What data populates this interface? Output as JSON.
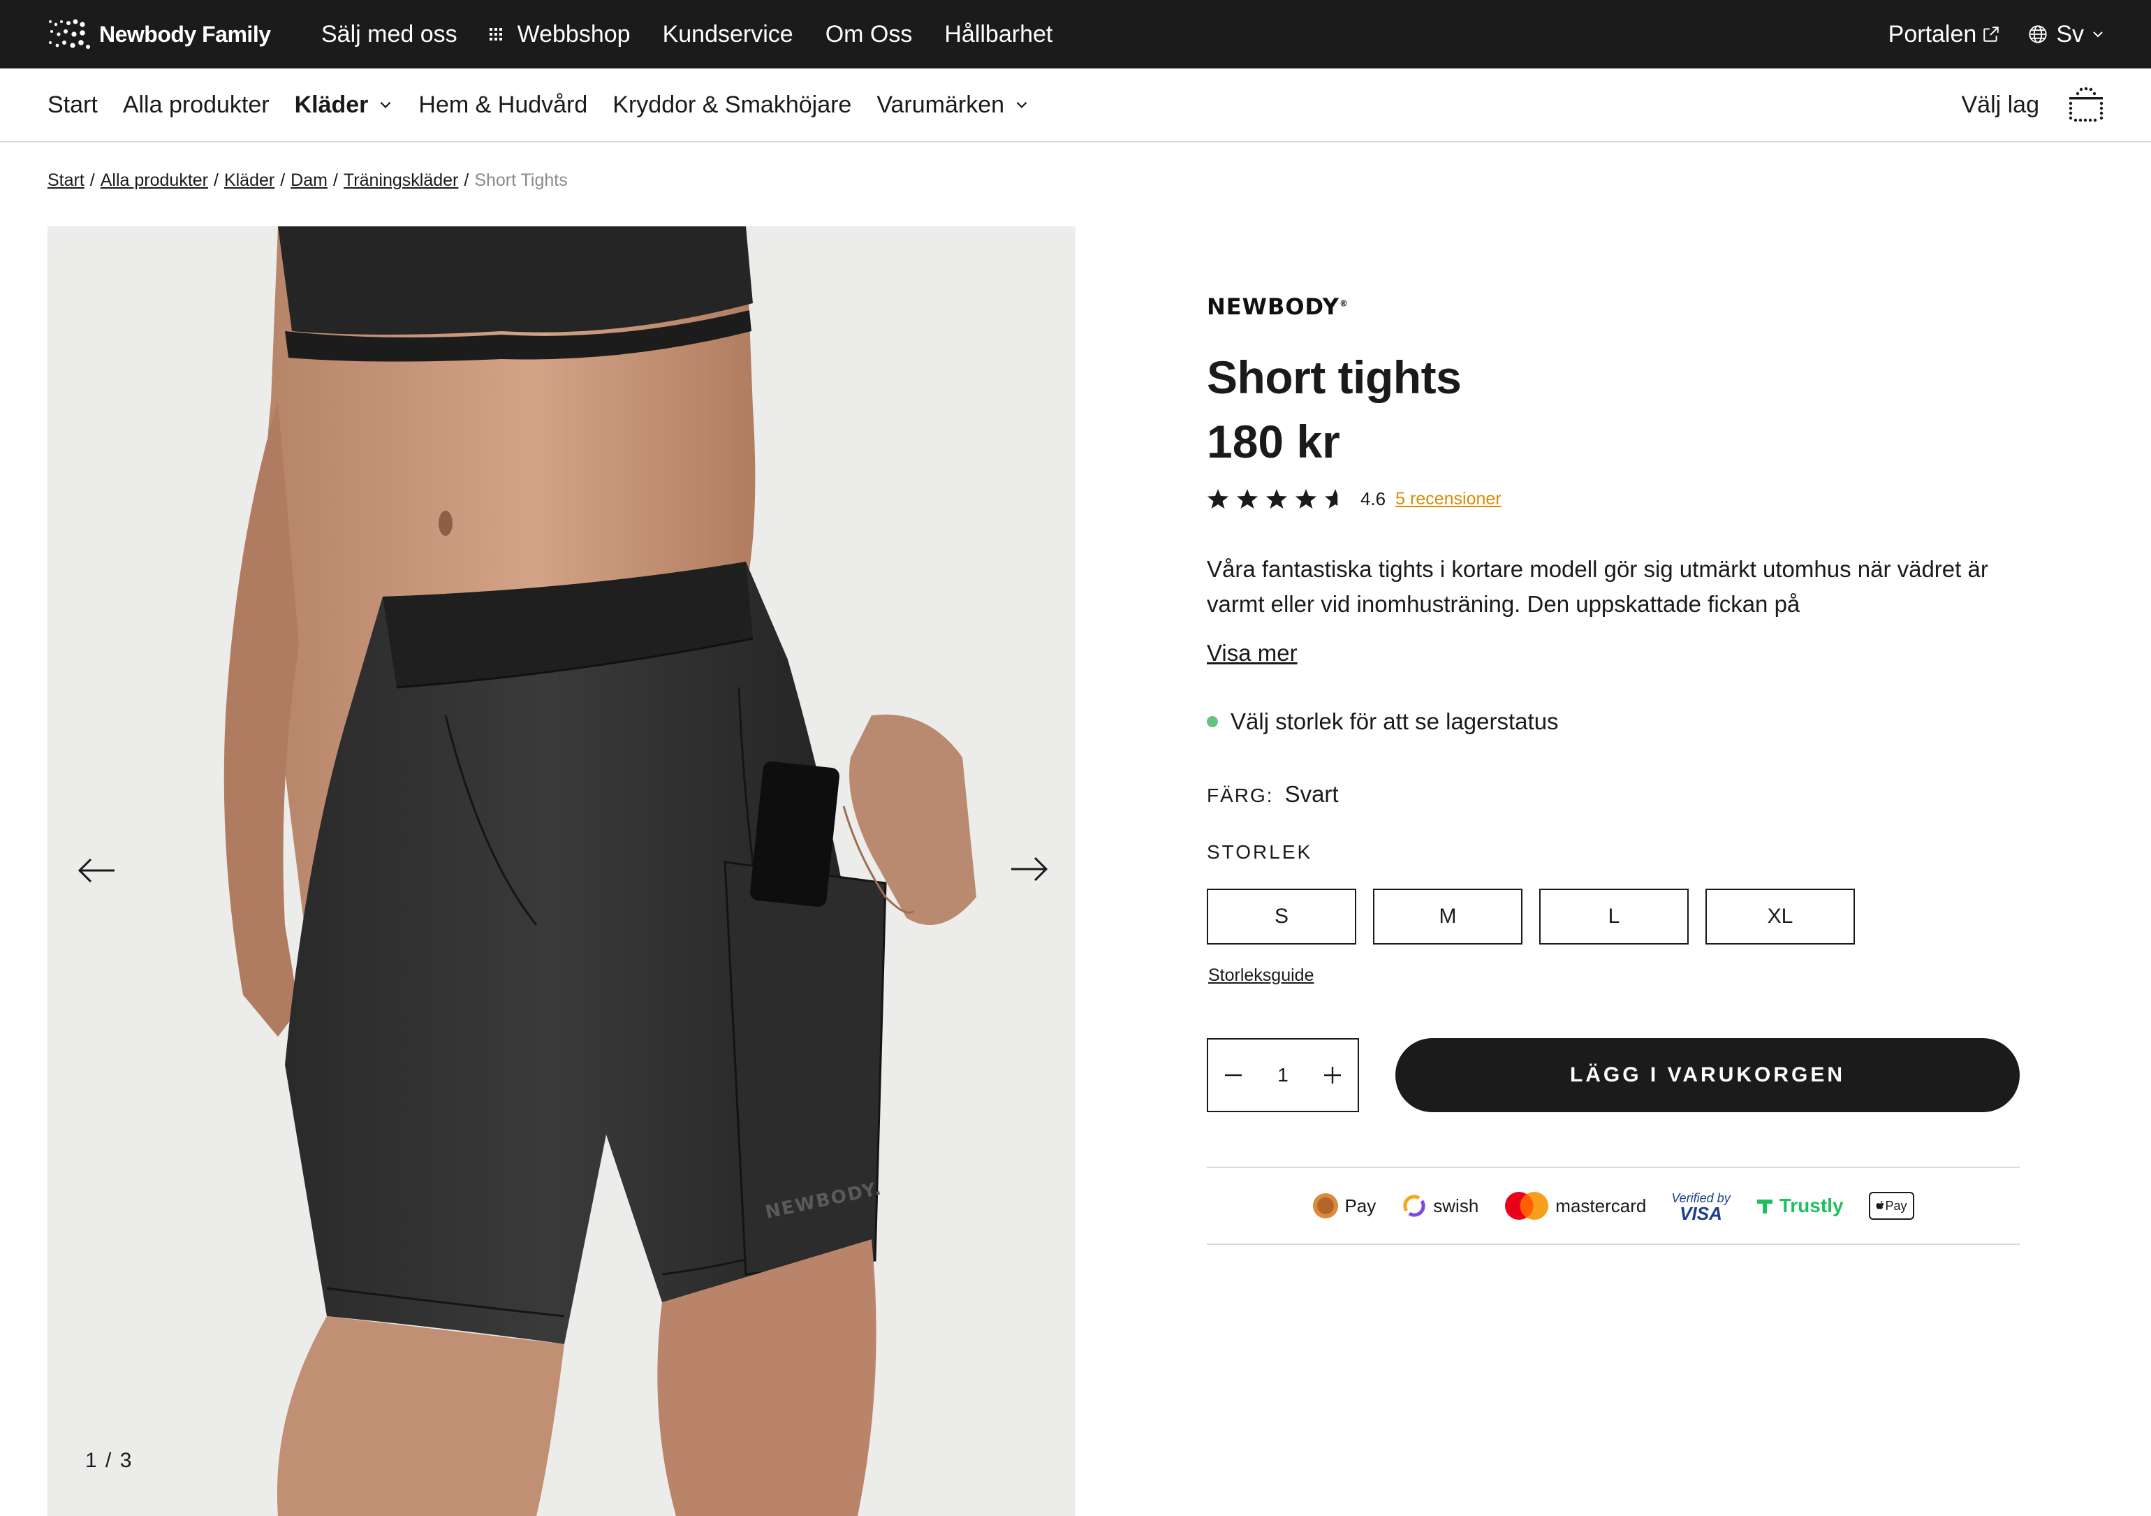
{
  "topbar": {
    "logo_text": "Newbody Family",
    "nav": [
      "Sälj med oss",
      "Webbshop",
      "Kundservice",
      "Om Oss",
      "Hållbarhet"
    ],
    "portal": "Portalen",
    "language": "Sv"
  },
  "mainnav": {
    "items": [
      "Start",
      "Alla produkter",
      "Kläder",
      "Hem & Hudvård",
      "Kryddor & Smakhöjare",
      "Varumärken"
    ],
    "team": "Välj lag"
  },
  "breadcrumb": {
    "links": [
      "Start",
      "Alla produkter",
      "Kläder",
      "Dam",
      "Träningskläder"
    ],
    "current": "Short Tights"
  },
  "gallery": {
    "counter": "1 / 3",
    "print": "NEWBODY."
  },
  "product": {
    "brand": "NEWBODY",
    "title": "Short tights",
    "price": "180 kr",
    "rating": 4.6,
    "rating_text": "4.6",
    "reviews": "5 recensioner",
    "description": "Våra fantastiska tights i kortare modell gör sig utmärkt utomhus när vädret är varmt eller vid inomhusträning. Den uppskattade fickan på",
    "show_more": "Visa mer",
    "stock": "Välj storlek för att se lagerstatus",
    "stock_color": "#65c281",
    "color_label": "FÄRG:",
    "color_value": "Svart",
    "size_label": "STORLEK",
    "sizes": [
      "S",
      "M",
      "L",
      "XL"
    ],
    "size_guide": "Storleksguide",
    "quantity": "1",
    "add_to_cart": "LÄGG I VARUKORGEN"
  },
  "payments": {
    "pay": "Pay",
    "swish": "swish",
    "mastercard": "mastercard",
    "visa_top": "Verified by",
    "visa_bottom": "VISA",
    "trustly": "Trustly",
    "applepay": "Pay"
  },
  "colors": {
    "topbar_bg": "#1b1b1b",
    "accent_link": "#d98a00",
    "stock_dot": "#65c281",
    "trustly": "#1fbf5e"
  }
}
